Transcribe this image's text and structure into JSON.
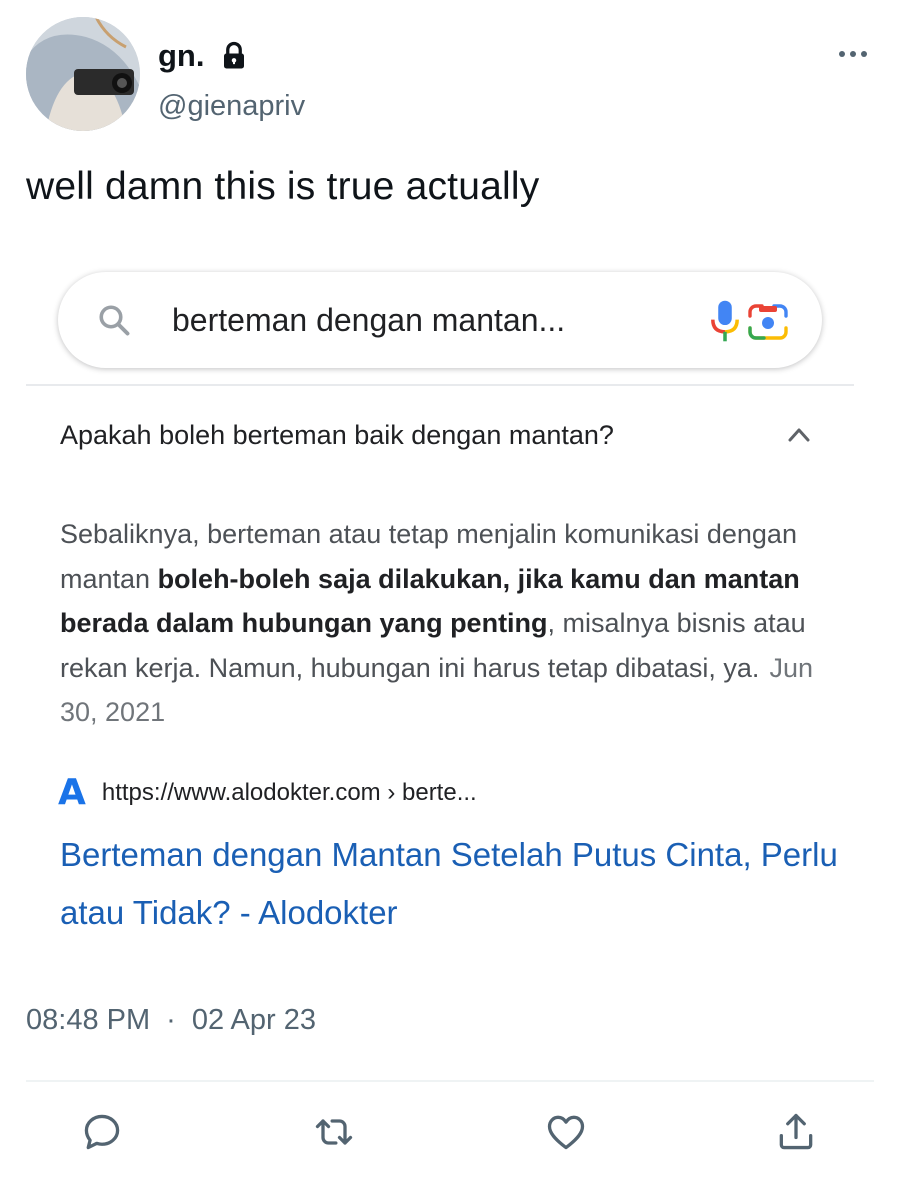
{
  "tweet": {
    "display_name": "gn.",
    "handle": "@gienapriv",
    "text": "well damn this is true actually",
    "time": "08:48 PM",
    "separator": "·",
    "date": "02 Apr 23"
  },
  "embedded_image": {
    "search_query": "berteman dengan mantan...",
    "question": "Apakah boleh berteman baik dengan mantan?",
    "answer": {
      "part1": "Sebaliknya, berteman atau tetap menjalin komunikasi dengan mantan ",
      "bold": "boleh-boleh saja dilakukan, jika kamu dan mantan berada dalam hubungan yang penting",
      "part2": ", misalnya bisnis atau rekan kerja. Namun, hubungan ini harus tetap dibatasi, ya.",
      "date": "Jun 30, 2021"
    },
    "source_logo": "A",
    "source_url": "https://www.alodokter.com › berte...",
    "result_title": "Berteman dengan Mantan Setelah Putus Cinta, Perlu atau Tidak? - Alodokter"
  },
  "icons": {
    "lock": "lock-icon",
    "more": "more-icon",
    "search": "search-icon",
    "mic": "mic-icon",
    "lens": "camera-lens-icon",
    "chevron": "chevron-up-icon",
    "reply": "reply-icon",
    "retweet": "retweet-icon",
    "like": "heart-icon",
    "share": "share-icon"
  },
  "colors": {
    "link": "#1a5fb4",
    "secondary_text": "#536471",
    "google_blue": "#1a73e8"
  }
}
